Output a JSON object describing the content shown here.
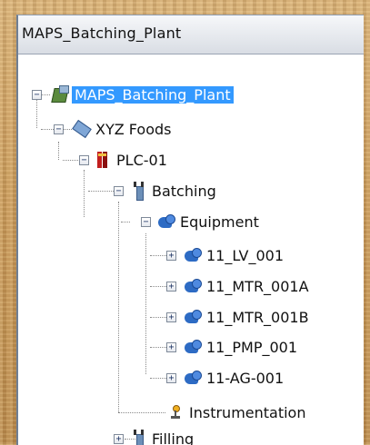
{
  "window": {
    "title": "MAPS_Batching_Plant"
  },
  "tree": {
    "root": {
      "label": "MAPS_Batching_Plant",
      "icon": "plant-icon",
      "expanded": true,
      "selected": true
    },
    "company": {
      "label": "XYZ Foods",
      "icon": "company-icon",
      "expanded": true
    },
    "plc": {
      "label": "PLC-01",
      "icon": "plc-icon",
      "expanded": true
    },
    "batching": {
      "label": "Batching",
      "icon": "area-icon",
      "expanded": true
    },
    "equipment": {
      "label": "Equipment",
      "icon": "equipment-icon",
      "expanded": true
    },
    "equipment_items": [
      {
        "label": "11_LV_001",
        "icon": "equipment-icon",
        "expanded": false
      },
      {
        "label": "11_MTR_001A",
        "icon": "equipment-icon",
        "expanded": false
      },
      {
        "label": "11_MTR_001B",
        "icon": "equipment-icon",
        "expanded": false
      },
      {
        "label": "11_PMP_001",
        "icon": "equipment-icon",
        "expanded": false
      },
      {
        "label": "11-AG-001",
        "icon": "equipment-icon",
        "expanded": false
      }
    ],
    "instrumentation": {
      "label": "Instrumentation",
      "icon": "instrument-icon"
    },
    "filling": {
      "label": "Filling",
      "icon": "area-icon",
      "expanded": false
    }
  },
  "toggle_symbols": {
    "expanded": "−",
    "collapsed": "+"
  },
  "colors": {
    "selection": "#3399ff",
    "background": "#caa265"
  }
}
